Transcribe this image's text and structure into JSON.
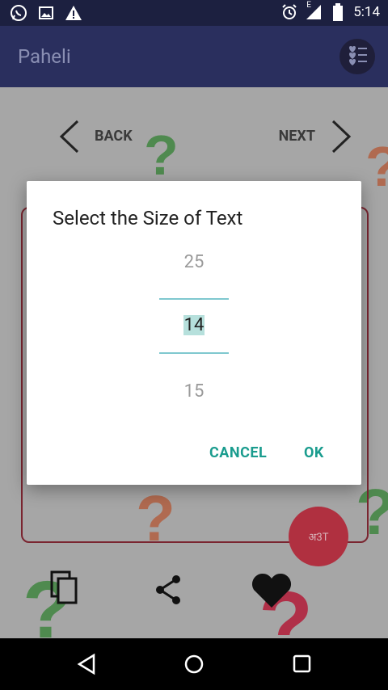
{
  "status_bar": {
    "time": "5:14",
    "network": "E",
    "icons": [
      "whatsapp-icon",
      "image-icon",
      "warning-icon",
      "alarm-icon",
      "signal-icon",
      "battery-icon"
    ]
  },
  "app_bar": {
    "title": "Paheli",
    "menu_icon": "list-hearts-icon"
  },
  "nav": {
    "back_label": "BACK",
    "next_label": "NEXT"
  },
  "fab": {
    "label": "अ3T"
  },
  "bottom_actions": [
    "copy-icon",
    "share-icon",
    "heart-icon"
  ],
  "dialog": {
    "title": "Select the Size of Text",
    "picker": {
      "previous": "25",
      "selected": "14",
      "next": "15"
    },
    "cancel_label": "CANCEL",
    "ok_label": "OK"
  },
  "colors": {
    "accent": "#1a9c8e",
    "app_bar": "#2a2f5e",
    "fab": "#b03040"
  }
}
